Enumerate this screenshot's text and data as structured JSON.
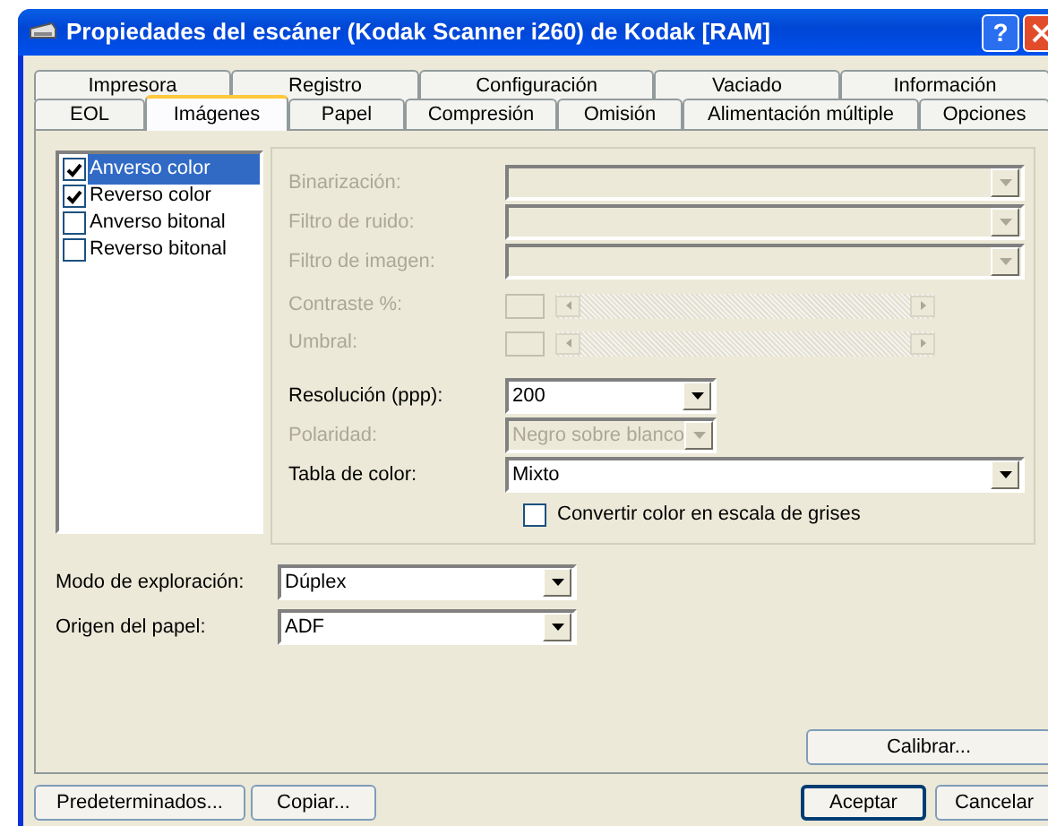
{
  "window": {
    "title": "Propiedades del escáner (Kodak Scanner i260) de Kodak [RAM]",
    "help_button": "?"
  },
  "tab_rows": [
    [
      {
        "label": "Impresora",
        "selected": false
      },
      {
        "label": "Registro",
        "selected": false
      },
      {
        "label": "Configuración",
        "selected": false
      },
      {
        "label": "Vaciado",
        "selected": false
      },
      {
        "label": "Información",
        "selected": false
      }
    ],
    [
      {
        "label": "EOL",
        "selected": false
      },
      {
        "label": "Imágenes",
        "selected": true
      },
      {
        "label": "Papel",
        "selected": false
      },
      {
        "label": "Compresión",
        "selected": false
      },
      {
        "label": "Omisión",
        "selected": false
      },
      {
        "label": "Alimentación múltiple",
        "selected": false
      },
      {
        "label": "Opciones",
        "selected": false
      }
    ]
  ],
  "image_list": [
    {
      "label": "Anverso color",
      "checked": true,
      "selected": true
    },
    {
      "label": "Reverso color",
      "checked": true,
      "selected": false
    },
    {
      "label": "Anverso bitonal",
      "checked": false,
      "selected": false
    },
    {
      "label": "Reverso bitonal",
      "checked": false,
      "selected": false
    }
  ],
  "settings": [
    {
      "kind": "dropdown",
      "label": "Binarización:",
      "disabled": true
    },
    {
      "kind": "dropdown",
      "label": "Filtro de ruido:",
      "disabled": true
    },
    {
      "kind": "dropdown",
      "label": "Filtro de imagen:",
      "disabled": true
    },
    {
      "kind": "slider",
      "label": "Contraste %:",
      "disabled": true
    },
    {
      "kind": "slider",
      "label": "Umbral:",
      "disabled": true
    },
    {
      "kind": "dropdown",
      "label": "Resolución (ppp):",
      "disabled": false,
      "value": "200"
    },
    {
      "kind": "dropdown",
      "label": "Polaridad:",
      "disabled": true,
      "value": "Negro sobre blanco"
    },
    {
      "kind": "dropdown",
      "label": "Tabla de color:",
      "disabled": false,
      "value": "Mixto"
    },
    {
      "kind": "checkbox",
      "label": "Convertir color en escala de grises",
      "checked": false
    }
  ],
  "scan_fields": [
    {
      "label": "Modo de exploración:",
      "value": "Dúplex"
    },
    {
      "label": "Origen del papel:",
      "value": "ADF"
    }
  ],
  "calibrate_button": "Calibrar...",
  "buttons": [
    {
      "label": "Predeterminados...",
      "default": false
    },
    {
      "label": "Copiar...",
      "default": false
    },
    {
      "label": "Aceptar",
      "default": true
    },
    {
      "label": "Cancelar",
      "default": false
    }
  ]
}
